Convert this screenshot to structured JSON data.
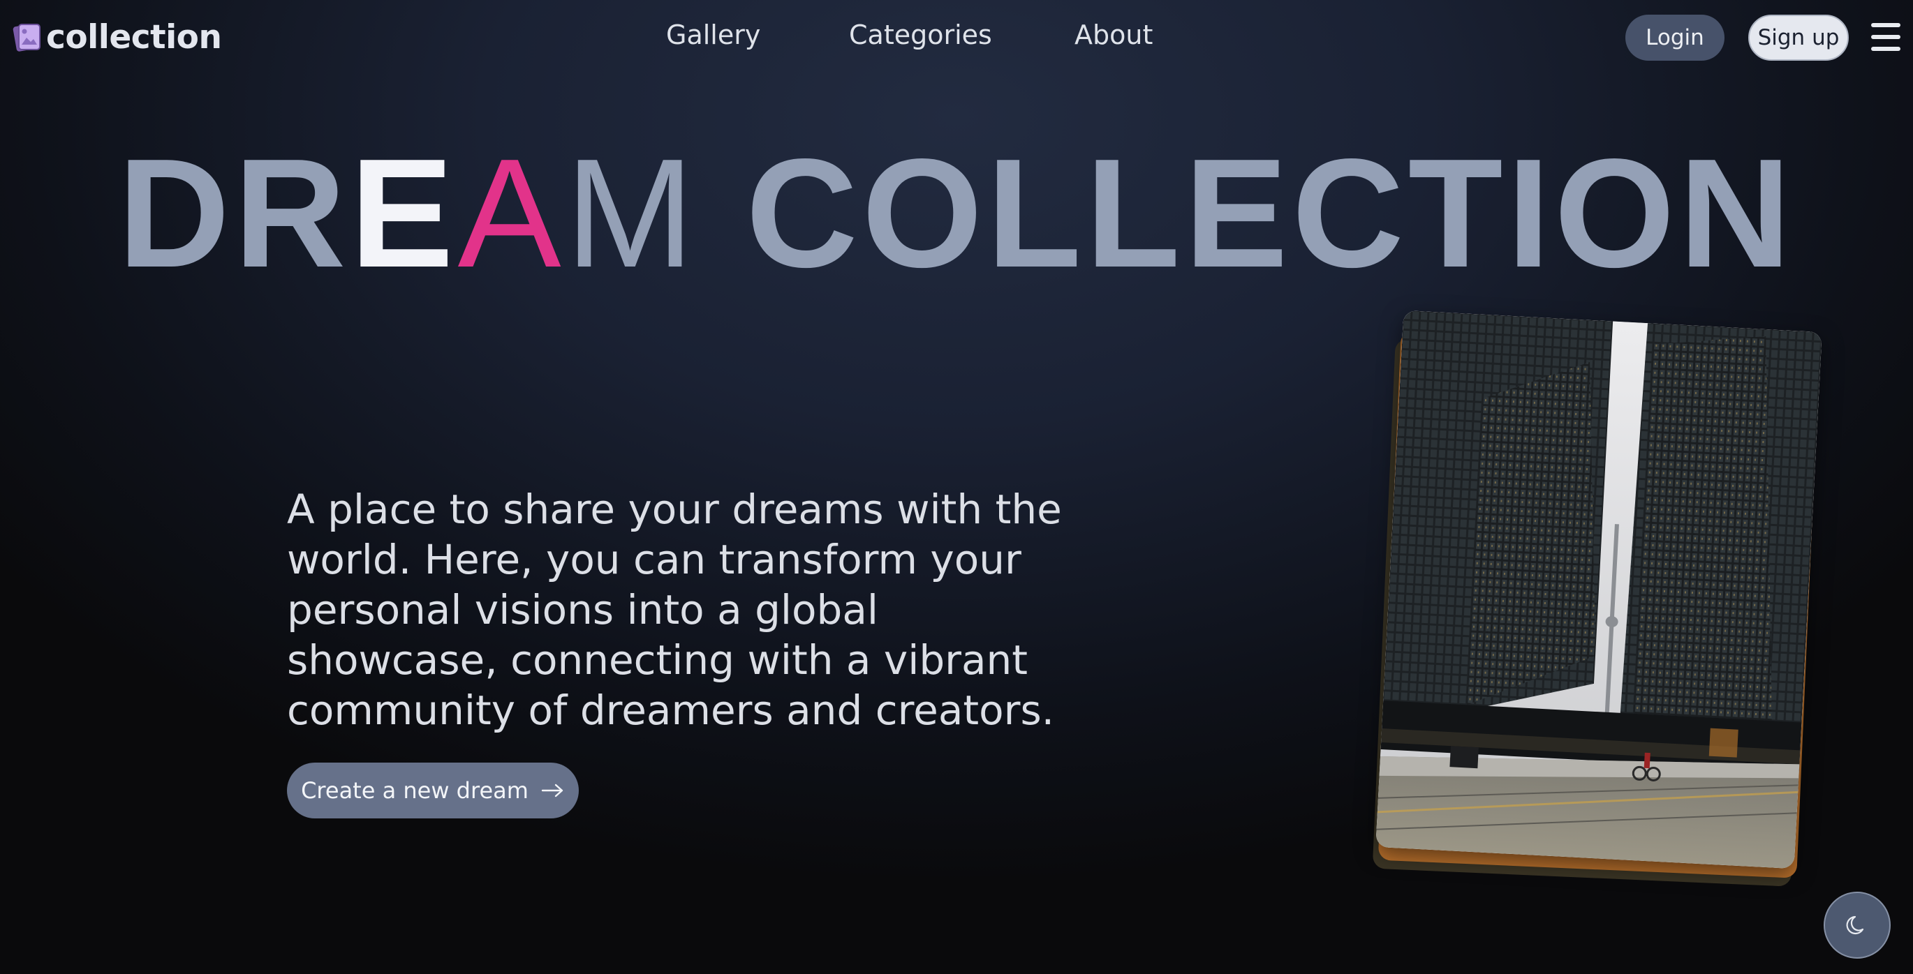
{
  "header": {
    "logo_text": "collection",
    "logo_icon": "photo-stack-icon",
    "nav": [
      {
        "label": "Gallery"
      },
      {
        "label": "Categories"
      },
      {
        "label": "About"
      }
    ],
    "login_label": "Login",
    "signup_label": "Sign up",
    "menu_icon": "hamburger-menu-icon"
  },
  "hero": {
    "title_parts": [
      "DR",
      "E",
      "A",
      "M",
      " COLLECTION"
    ],
    "description": "A place to share your dreams with the world. Here, you can transform your personal visions into a global showcase, connecting with a vibrant community of dreamers and creators.",
    "cta_label": "Create a new dream",
    "cta_icon": "arrow-right-icon",
    "image_icon": "city-skyscrapers-photo"
  },
  "theme_toggle": {
    "icon": "moon-icon"
  },
  "colors": {
    "accent_pink": "#e2338a",
    "title_gray": "#94a0b6",
    "title_white": "#f3f4f9",
    "cta_background": "#66718a",
    "login_background": "#47526a",
    "signup_background": "#e5e8ef"
  }
}
